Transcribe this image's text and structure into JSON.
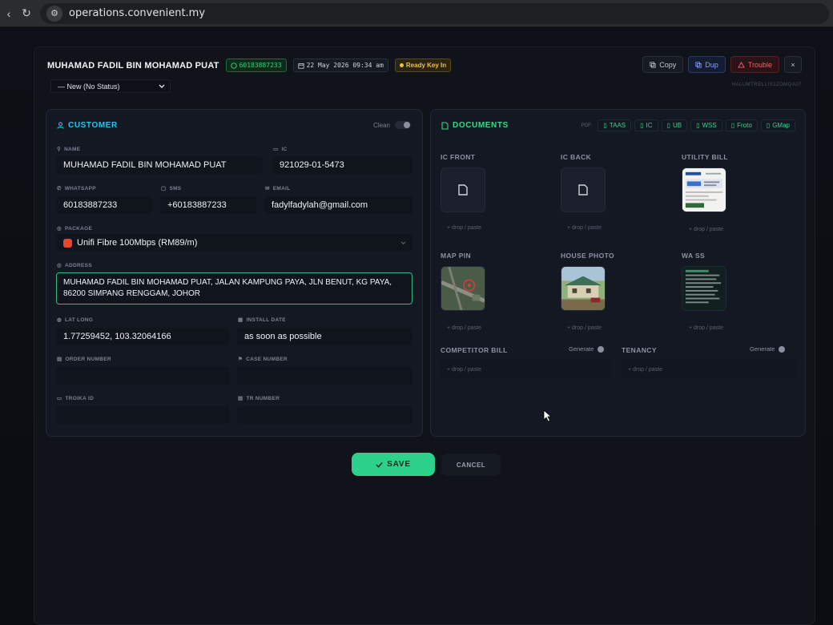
{
  "browser": {
    "url": "operations.convenient.my",
    "back_icon": "‹",
    "reload_icon": "↻",
    "site_icon": "⚙"
  },
  "header": {
    "customer_name": "MUHAMAD FADIL BIN MOHAMAD PUAT",
    "whatsapp": "60183887233",
    "datetime": "22 May 2026 09:34 am",
    "status_badge": "Ready Key In",
    "status_select": "— New (No Status)",
    "copy_label": "Copy",
    "dup_label": "Dup",
    "trouble_label": "Trouble",
    "close_label": "×",
    "subnote": "HALUMTRELLIS2ZOMQA07"
  },
  "customer": {
    "title": "CUSTOMER",
    "clean_label": "Clean",
    "name_label": "NAME",
    "name": "MUHAMAD FADIL BIN MOHAMAD PUAT",
    "ic_label": "IC",
    "ic": "921029-01-5473",
    "whatsapp_label": "WHATSAPP",
    "whatsapp": "60183887233",
    "sms_label": "SMS",
    "sms": "+60183887233",
    "email_label": "EMAIL",
    "email": "fadylfadylah@gmail.com",
    "package_label": "PACKAGE",
    "package": "Unifi Fibre 100Mbps (RM89/m)",
    "address_label": "ADDRESS",
    "address": "MUHAMAD FADIL BIN MOHAMAD PUAT, JALAN KAMPUNG PAYA, JLN BENUT, KG PAYA, 86200 SIMPANG RENGGAM, JOHOR",
    "latlong_label": "LAT LONG",
    "latlong": "1.77259452, 103.32064166",
    "install_label": "INSTALL DATE",
    "install_date": "as soon as possible",
    "order_label": "ORDER NUMBER",
    "order_number": "",
    "case_label": "CASE NUMBER",
    "case_number": "",
    "troika_label": "TROIKA ID",
    "troika_id": "",
    "tr_label": "TR NUMBER",
    "tr_number": ""
  },
  "documents": {
    "title": "DOCUMENTS",
    "pdf_label": "PDF:",
    "pdf_buttons": [
      "TAAS",
      "IC",
      "UB",
      "WSS",
      "Froto",
      "GMap"
    ],
    "ic_front": "IC FRONT",
    "ic_back": "IC BACK",
    "utility_bill": "UTILITY BILL",
    "map_pin": "MAP PIN",
    "house_photo": "HOUSE PHOTO",
    "wa_ss": "WA SS",
    "competitor_bill": "COMPETITOR BILL",
    "tenancy": "TENANCY",
    "generate": "Generate",
    "drop_paste": "+ drop / paste"
  },
  "footer": {
    "save_label": "SAVE",
    "cancel_label": "CANCEL"
  },
  "colors": {
    "accent_cyan": "#27c5e8",
    "accent_green": "#2ed189",
    "danger": "#f0606d",
    "blue": "#7ea4ff"
  }
}
